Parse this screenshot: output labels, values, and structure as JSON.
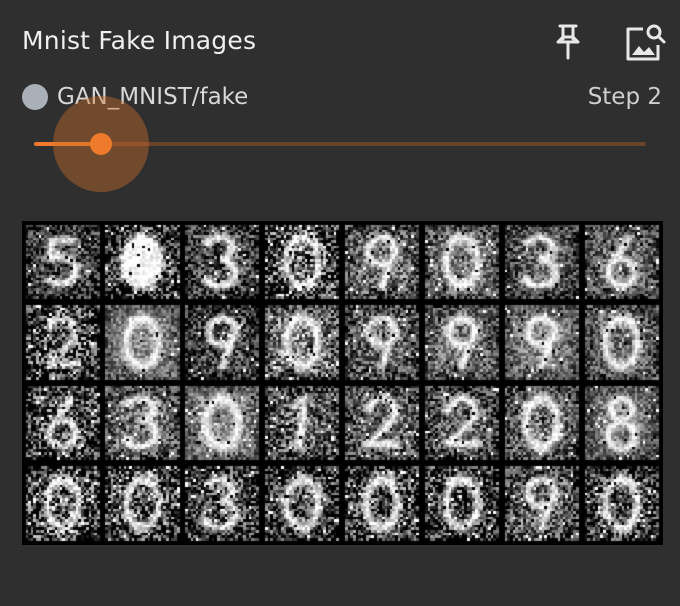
{
  "card": {
    "title": "Mnist Fake Images",
    "run_name": "GAN_MNIST/fake",
    "run_color": "#aab0b8",
    "step_label": "Step 2",
    "accent_color": "#ef7a2c"
  },
  "actions": {
    "pin_icon": "pin-icon",
    "image_settings_icon": "image-settings-icon"
  },
  "slider": {
    "step_fraction": 0.11
  },
  "image_grid": {
    "rows": 4,
    "cols": 8,
    "cells": [
      {
        "digit": "5",
        "noise": 0.35,
        "bg": 0.3
      },
      {
        "digit": "blob",
        "noise": 0.55,
        "bg": 0.22
      },
      {
        "digit": "3",
        "noise": 0.35,
        "bg": 0.32
      },
      {
        "digit": "0",
        "noise": 0.6,
        "bg": 0.3
      },
      {
        "digit": "9",
        "noise": 0.35,
        "bg": 0.45
      },
      {
        "digit": "0",
        "noise": 0.3,
        "bg": 0.48
      },
      {
        "digit": "3",
        "noise": 0.3,
        "bg": 0.4
      },
      {
        "digit": "6",
        "noise": 0.3,
        "bg": 0.42
      },
      {
        "digit": "2",
        "noise": 0.6,
        "bg": 0.25
      },
      {
        "digit": "0",
        "noise": 0.25,
        "bg": 0.55
      },
      {
        "digit": "9",
        "noise": 0.35,
        "bg": 0.3
      },
      {
        "digit": "0",
        "noise": 0.4,
        "bg": 0.5
      },
      {
        "digit": "9",
        "noise": 0.35,
        "bg": 0.4
      },
      {
        "digit": "9",
        "noise": 0.3,
        "bg": 0.48
      },
      {
        "digit": "9",
        "noise": 0.25,
        "bg": 0.52
      },
      {
        "digit": "0",
        "noise": 0.3,
        "bg": 0.45
      },
      {
        "digit": "6",
        "noise": 0.5,
        "bg": 0.3
      },
      {
        "digit": "3",
        "noise": 0.35,
        "bg": 0.45
      },
      {
        "digit": "0",
        "noise": 0.25,
        "bg": 0.58
      },
      {
        "digit": "1",
        "noise": 0.4,
        "bg": 0.4
      },
      {
        "digit": "2",
        "noise": 0.35,
        "bg": 0.42
      },
      {
        "digit": "2",
        "noise": 0.35,
        "bg": 0.4
      },
      {
        "digit": "0",
        "noise": 0.35,
        "bg": 0.45
      },
      {
        "digit": "8",
        "noise": 0.25,
        "bg": 0.5
      },
      {
        "digit": "0",
        "noise": 0.6,
        "bg": 0.28
      },
      {
        "digit": "0",
        "noise": 0.55,
        "bg": 0.3
      },
      {
        "digit": "3",
        "noise": 0.45,
        "bg": 0.3
      },
      {
        "digit": "0",
        "noise": 0.45,
        "bg": 0.28
      },
      {
        "digit": "0",
        "noise": 0.5,
        "bg": 0.3
      },
      {
        "digit": "0",
        "noise": 0.5,
        "bg": 0.25
      },
      {
        "digit": "9",
        "noise": 0.4,
        "bg": 0.4
      },
      {
        "digit": "0",
        "noise": 0.45,
        "bg": 0.3
      }
    ]
  }
}
